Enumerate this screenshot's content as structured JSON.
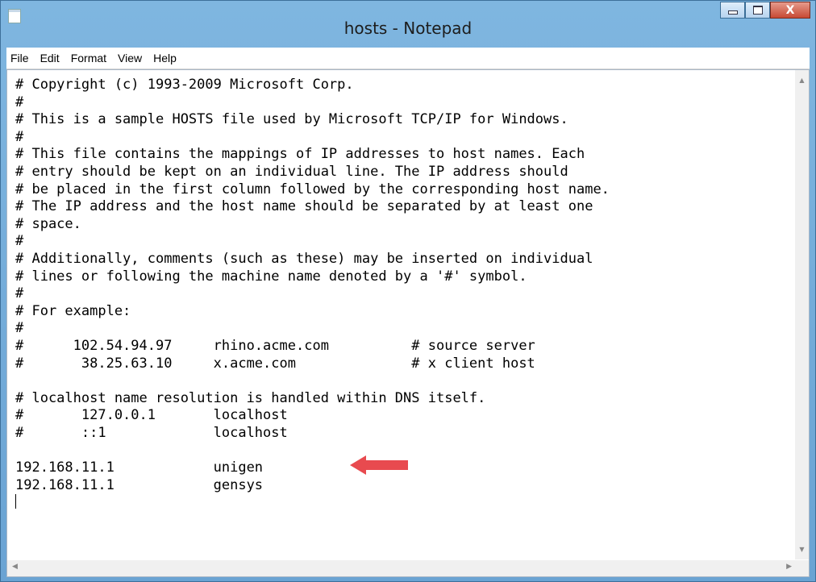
{
  "window": {
    "title": "hosts - Notepad",
    "controls": {
      "minimize": "",
      "maximize": "",
      "close": "X"
    }
  },
  "menu": [
    "File",
    "Edit",
    "Format",
    "View",
    "Help"
  ],
  "editor": {
    "lines": [
      "# Copyright (c) 1993-2009 Microsoft Corp.",
      "#",
      "# This is a sample HOSTS file used by Microsoft TCP/IP for Windows.",
      "#",
      "# This file contains the mappings of IP addresses to host names. Each",
      "# entry should be kept on an individual line. The IP address should",
      "# be placed in the first column followed by the corresponding host name.",
      "# The IP address and the host name should be separated by at least one",
      "# space.",
      "#",
      "# Additionally, comments (such as these) may be inserted on individual",
      "# lines or following the machine name denoted by a '#' symbol.",
      "#",
      "# For example:",
      "#",
      "#      102.54.94.97     rhino.acme.com          # source server",
      "#       38.25.63.10     x.acme.com              # x client host",
      "",
      "# localhost name resolution is handled within DNS itself.",
      "#       127.0.0.1       localhost",
      "#       ::1             localhost",
      "",
      "192.168.11.1            unigen",
      "192.168.11.1            gensys"
    ]
  },
  "annotation": {
    "color": "#e84a4f",
    "points_to": "unigen"
  }
}
